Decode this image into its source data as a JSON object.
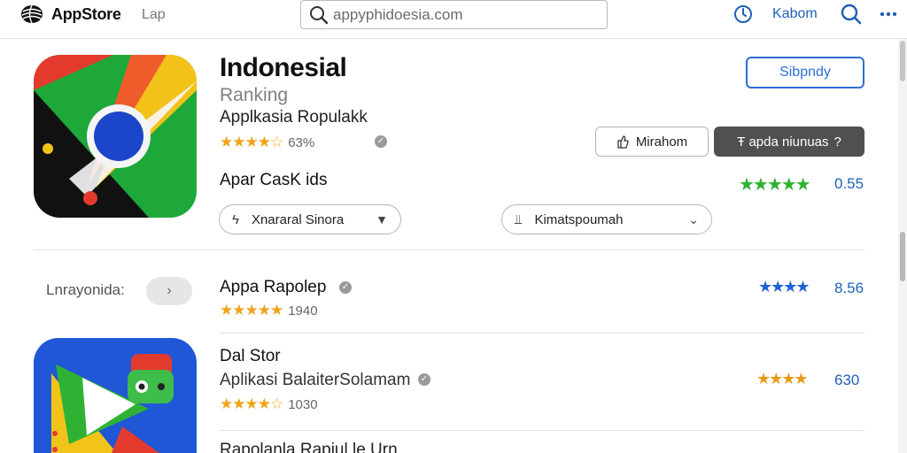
{
  "topbar": {
    "app_name": "AppStore",
    "tab": "Lap",
    "search_value": "appyphidoesia.com",
    "account_label": "Kabom"
  },
  "hero": {
    "title": "Indonesial",
    "subtitle": "Ranking",
    "category": "Applkasia Ropulakk",
    "stars": "★★★★☆",
    "rating": "63%",
    "developer": "Apar CasK ids",
    "primary_button": "Sibpndy",
    "secondary_button": "Mirahom",
    "dark_button": "Ŧ apda niunuas",
    "dark_button_icon": "?",
    "green_stars": "★★★★★",
    "green_score": "0.55",
    "dropdown_left": "Xnararal Sinora",
    "dropdown_right": "Kimatspoumah"
  },
  "list": {
    "section_label": "Lnrayonida:",
    "items": [
      {
        "title": "Appa Rapolep",
        "stars": "★★★★★",
        "rating": "1940",
        "right_stars": "★★★★",
        "score": "8.56"
      },
      {
        "title": "Dal Stor",
        "subtitle": "Aplikasi BalaiterSolamam",
        "stars": "★★★★☆",
        "rating": "1030",
        "right_stars": "★★★★",
        "score": "630"
      }
    ],
    "cutoff_item": "Rapolanla Rapiul le Urn"
  },
  "colors": {
    "accent_blue": "#2d6fd6",
    "link_blue": "#1f5fb8",
    "star_gold": "#f0a219",
    "star_green": "#2fb233",
    "dark_button": "#505050"
  },
  "icons": {
    "logo": "globe-logo-icon",
    "search": "search-icon",
    "history": "clock-icon",
    "more": "more-dots-icon",
    "verified": "verified-badge-icon"
  }
}
